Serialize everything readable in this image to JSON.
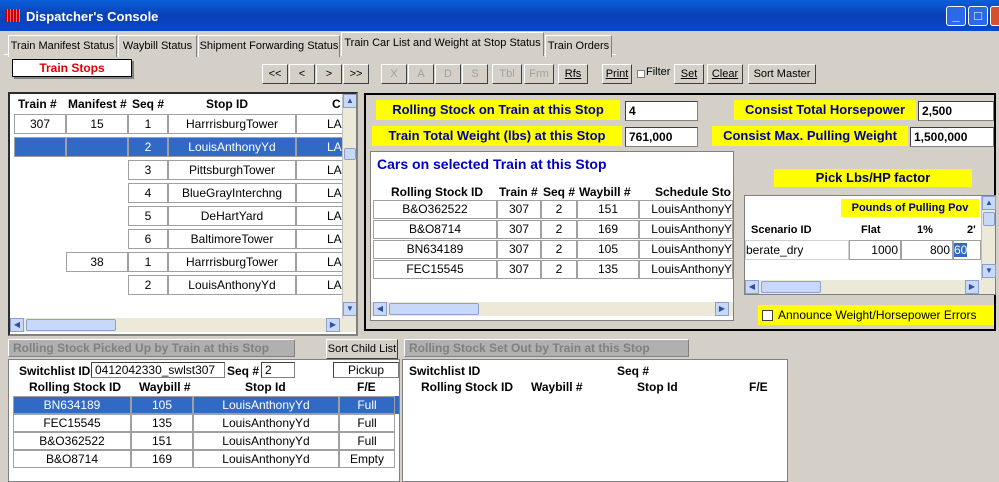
{
  "window": {
    "title": "Dispatcher's Console"
  },
  "tabs": [
    "Train Manifest Status",
    "Waybill Status",
    "Shipment Forwarding Status",
    "Train Car List and Weight at Stop Status",
    "Train Orders"
  ],
  "train_stops_label": "Train Stops",
  "nav": {
    "first": "<<",
    "prev": "<",
    "next": ">",
    "last": ">>",
    "x": "X",
    "a": "A",
    "d": "D",
    "s": "S",
    "tbl": "Tbl",
    "frm": "Frm",
    "rfs": "Rfs"
  },
  "actions": {
    "print": "Print",
    "filter": "Filter",
    "set": "Set",
    "clear": "Clear",
    "sort_master": "Sort Master"
  },
  "stops_grid": {
    "headers": [
      "Train #",
      "Manifest #",
      "Seq #",
      "Stop ID",
      "C"
    ],
    "rows": [
      {
        "train": "307",
        "manifest": "15",
        "seq": "1",
        "stop": "HarrrisburgTower",
        "c": "LA"
      },
      {
        "train": "",
        "manifest": "",
        "seq": "2",
        "stop": "LouisAnthonyYd",
        "c": "LA"
      },
      {
        "train": "",
        "manifest": "",
        "seq": "3",
        "stop": "PittsburghTower",
        "c": "LA"
      },
      {
        "train": "",
        "manifest": "",
        "seq": "4",
        "stop": "BlueGrayInterchng",
        "c": "LA"
      },
      {
        "train": "",
        "manifest": "",
        "seq": "5",
        "stop": "DeHartYard",
        "c": "LA"
      },
      {
        "train": "",
        "manifest": "",
        "seq": "6",
        "stop": "BaltimoreTower",
        "c": "LA"
      },
      {
        "train": "",
        "manifest": "38",
        "seq": "1",
        "stop": "HarrrisburgTower",
        "c": "LA"
      },
      {
        "train": "",
        "manifest": "",
        "seq": "2",
        "stop": "LouisAnthonyYd",
        "c": "LA"
      }
    ]
  },
  "summary": {
    "rolling_stock_label": "Rolling Stock on Train at this Stop",
    "rolling_stock_value": "4",
    "total_weight_label": "Train Total Weight (lbs) at this Stop",
    "total_weight_value": "761,000",
    "horsepower_label": "Consist Total Horsepower",
    "horsepower_value": "2,500",
    "max_pull_label": "Consist Max. Pulling Weight",
    "max_pull_value": "1,500,000"
  },
  "cars_grid": {
    "title": "Cars on selected Train at this Stop",
    "headers": [
      "Rolling Stock ID",
      "Train #",
      "Seq #",
      "Waybill #",
      "Schedule Sto"
    ],
    "rows": [
      {
        "id": "B&O362522",
        "train": "307",
        "seq": "2",
        "waybill": "151",
        "sched": "LouisAnthonyY"
      },
      {
        "id": "B&O8714",
        "train": "307",
        "seq": "2",
        "waybill": "169",
        "sched": "LouisAnthonyY"
      },
      {
        "id": "BN634189",
        "train": "307",
        "seq": "2",
        "waybill": "105",
        "sched": "LouisAnthonyY"
      },
      {
        "id": "FEC15545",
        "train": "307",
        "seq": "2",
        "waybill": "135",
        "sched": "LouisAnthonyY"
      }
    ]
  },
  "lbs_hp": {
    "title": "Pick Lbs/HP factor",
    "subtitle": "Pounds of Pulling Pov",
    "headers": [
      "Scenario ID",
      "Flat",
      "1%",
      "2'"
    ],
    "row": {
      "scenario": "berate_dry",
      "flat": "1000",
      "one": "800",
      "two": "60"
    },
    "announce_label": "Announce Weight/Horsepower Errors"
  },
  "picked_up": {
    "label": "Rolling Stock Picked Up by Train at this Stop",
    "sort_child": "Sort Child List",
    "switchlist_label": "Switchlist ID",
    "switchlist_value": "0412042330_swlst307",
    "seq_label": "Seq #",
    "seq_value": "2",
    "type_value": "Pickup",
    "headers": [
      "Rolling Stock ID",
      "Waybill #",
      "Stop Id",
      "F/E"
    ],
    "rows": [
      {
        "id": "BN634189",
        "waybill": "105",
        "stop": "LouisAnthonyYd",
        "fe": "Full"
      },
      {
        "id": "FEC15545",
        "waybill": "135",
        "stop": "LouisAnthonyYd",
        "fe": "Full"
      },
      {
        "id": "B&O362522",
        "waybill": "151",
        "stop": "LouisAnthonyYd",
        "fe": "Full"
      },
      {
        "id": "B&O8714",
        "waybill": "169",
        "stop": "LouisAnthonyYd",
        "fe": "Empty"
      }
    ]
  },
  "set_out": {
    "label": "Rolling Stock Set Out by Train at this Stop",
    "switchlist_label": "Switchlist ID",
    "seq_label": "Seq #",
    "headers": [
      "Rolling Stock ID",
      "Waybill #",
      "Stop Id",
      "F/E"
    ]
  }
}
